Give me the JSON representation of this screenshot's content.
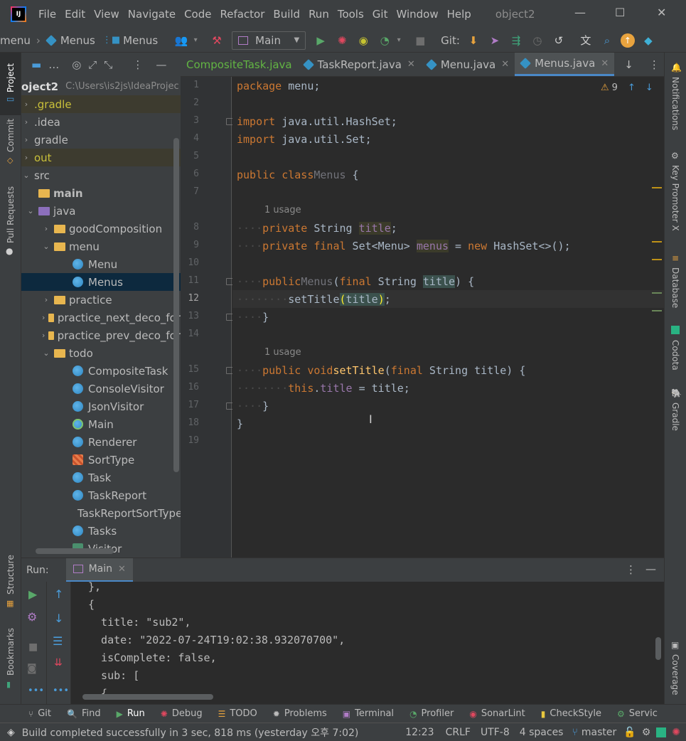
{
  "menubar": {
    "items": [
      "File",
      "Edit",
      "View",
      "Navigate",
      "Code",
      "Refactor",
      "Build",
      "Run",
      "Tools",
      "Git",
      "Window",
      "Help"
    ],
    "project_title": "object2"
  },
  "toolbar": {
    "crumb1": "menu",
    "crumb2": "Menus",
    "crumb3": "Menus",
    "run_config": "Main",
    "git_label": "Git:"
  },
  "left_tools": {
    "project": "Project",
    "commit": "Commit",
    "pull_requests": "Pull Requests",
    "structure": "Structure",
    "bookmarks": "Bookmarks"
  },
  "right_tools": {
    "notifications": "Notifications",
    "key_promoter": "Key Promoter X",
    "database": "Database",
    "codota": "Codota",
    "gradle": "Gradle",
    "coverage": "Coverage"
  },
  "project": {
    "header_dots": "…",
    "root_name": "oject2",
    "root_path": "C:\\Users\\is2js\\IdeaProjec",
    "tree": [
      {
        "label": ".gradle",
        "kind": "folder",
        "indent": 0,
        "arrow": "›",
        "hl": true
      },
      {
        "label": ".idea",
        "kind": "folder",
        "indent": 0,
        "arrow": "›"
      },
      {
        "label": "gradle",
        "kind": "folder",
        "indent": 0,
        "arrow": "›"
      },
      {
        "label": "out",
        "kind": "folder",
        "indent": 0,
        "arrow": "›",
        "hl": true,
        "yellow": true
      },
      {
        "label": "src",
        "kind": "folder",
        "indent": 0,
        "arrow": "⌄"
      },
      {
        "label": "main",
        "kind": "folder",
        "indent": 1,
        "arrow": "",
        "bold": true
      },
      {
        "label": "java",
        "kind": "folder-purple",
        "indent": 1,
        "arrow": "⌄"
      },
      {
        "label": "goodComposition",
        "kind": "folder",
        "indent": 2,
        "arrow": "›"
      },
      {
        "label": "menu",
        "kind": "folder",
        "indent": 2,
        "arrow": "⌄"
      },
      {
        "label": "Menu",
        "kind": "class",
        "indent": 3,
        "arrow": ""
      },
      {
        "label": "Menus",
        "kind": "class",
        "indent": 3,
        "arrow": "",
        "selected": true
      },
      {
        "label": "practice",
        "kind": "folder",
        "indent": 2,
        "arrow": "›"
      },
      {
        "label": "practice_next_deco_for",
        "kind": "folder",
        "indent": 2,
        "arrow": "›"
      },
      {
        "label": "practice_prev_deco_for",
        "kind": "folder",
        "indent": 2,
        "arrow": "›"
      },
      {
        "label": "todo",
        "kind": "folder",
        "indent": 2,
        "arrow": "⌄"
      },
      {
        "label": "CompositeTask",
        "kind": "class",
        "indent": 3,
        "arrow": ""
      },
      {
        "label": "ConsoleVisitor",
        "kind": "class",
        "indent": 3,
        "arrow": ""
      },
      {
        "label": "JsonVisitor",
        "kind": "class",
        "indent": 3,
        "arrow": ""
      },
      {
        "label": "Main",
        "kind": "main",
        "indent": 3,
        "arrow": ""
      },
      {
        "label": "Renderer",
        "kind": "class",
        "indent": 3,
        "arrow": ""
      },
      {
        "label": "SortType",
        "kind": "enum",
        "indent": 3,
        "arrow": ""
      },
      {
        "label": "Task",
        "kind": "class",
        "indent": 3,
        "arrow": ""
      },
      {
        "label": "TaskReport",
        "kind": "class",
        "indent": 3,
        "arrow": ""
      },
      {
        "label": "TaskReportSortType",
        "kind": "enum",
        "indent": 3,
        "arrow": ""
      },
      {
        "label": "Tasks",
        "kind": "class",
        "indent": 3,
        "arrow": ""
      },
      {
        "label": "Visitor",
        "kind": "iface",
        "indent": 3,
        "arrow": ""
      }
    ]
  },
  "tabs": [
    {
      "label": "CompositeTask.java",
      "icon": false,
      "active": false
    },
    {
      "label": "TaskReport.java",
      "icon": true,
      "active": false
    },
    {
      "label": "Menu.java",
      "icon": true,
      "active": false
    },
    {
      "label": "Menus.java",
      "icon": true,
      "active": true
    }
  ],
  "editor": {
    "warning_count": "9",
    "usage_label": "1 usage",
    "line_numbers": [
      "1",
      "2",
      "3",
      "4",
      "5",
      "6",
      "7",
      "8",
      "9",
      "10",
      "11",
      "12",
      "13",
      "14",
      "15",
      "16",
      "17",
      "18",
      "19"
    ],
    "current_line": "12"
  },
  "run_panel": {
    "label": "Run:",
    "tab": "Main",
    "console_lines": [
      "},",
      "{",
      "  title: \"sub2\",",
      "  date: \"2022-07-24T19:02:38.932070700\",",
      "  isComplete: false,",
      "  sub: [",
      "  {"
    ]
  },
  "bottom_tools": [
    "Git",
    "Find",
    "Run",
    "Debug",
    "TODO",
    "Problems",
    "Terminal",
    "Profiler",
    "SonarLint",
    "CheckStyle",
    "Servic"
  ],
  "status": {
    "message": "Build completed successfully in 3 sec, 818 ms (yesterday 오후 7:02)",
    "position": "12:23",
    "line_sep": "CRLF",
    "encoding": "UTF-8",
    "indent": "4 spaces",
    "branch": "master"
  },
  "colors": {
    "accent": "#4a88c7",
    "keyword": "#cc7832",
    "field": "#9876aa",
    "function": "#ffc66d",
    "string": "#6a8759"
  }
}
